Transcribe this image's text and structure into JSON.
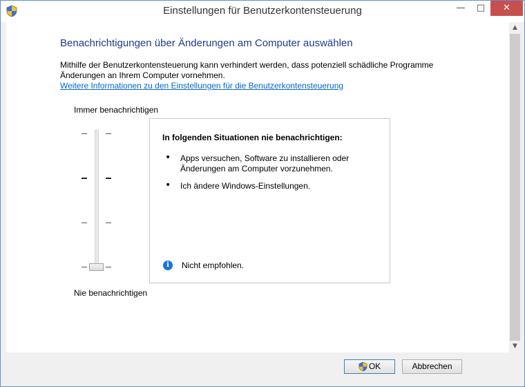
{
  "window": {
    "title": "Einstellungen für Benutzerkontensteuerung",
    "minimize_label": "—",
    "maximize_label": "□",
    "close_label": "✕"
  },
  "main": {
    "heading": "Benachrichtigungen über Änderungen am Computer auswählen",
    "description_line1": "Mithilfe der Benutzerkontensteuerung kann verhindert werden, dass potenziell schädliche Programme",
    "description_line2": "Änderungen an Ihrem Computer vornehmen.",
    "link": "Weitere Informationen zu den Einstellungen für die Benutzerkontensteuerung"
  },
  "slider": {
    "top_label": "Immer benachrichtigen",
    "bottom_label": "Nie benachrichtigen",
    "levels": 4,
    "selected_level": 1
  },
  "infobox": {
    "title": "In folgenden Situationen nie benachrichtigen:",
    "bullets": [
      "Apps versuchen, Software zu installieren oder Änderungen am Computer vorzunehmen.",
      "Ich ändere Windows-Einstellungen."
    ],
    "recommendation": "Nicht empfohlen."
  },
  "buttons": {
    "ok": "OK",
    "cancel": "Abbrechen"
  },
  "colors": {
    "heading": "#1e3c8c",
    "link": "#0066cc",
    "close_button": "#c7504e"
  },
  "icons": {
    "title": "shield-icon",
    "info": "info-icon",
    "ok": "shield-icon"
  }
}
